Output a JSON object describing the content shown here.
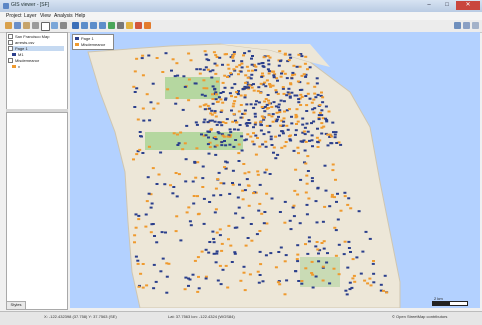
{
  "window": {
    "title": "GIS viewer - [SF]",
    "min": "–",
    "max": "□",
    "close": "✕"
  },
  "menus": [
    "Project",
    "Layer",
    "View",
    "Analysis",
    "Help"
  ],
  "sidebar": {
    "layers": [
      {
        "label": "San Francisco Map"
      },
      {
        "label": "arrests.csv"
      },
      {
        "label": "Page 1"
      },
      {
        "label": "M1"
      },
      {
        "label": "Misdemeanor"
      },
      {
        "label": "v"
      }
    ],
    "panel_tab": "Styles"
  },
  "legend": {
    "items": [
      {
        "label": "Page 1",
        "color": "#2b3f8c"
      },
      {
        "label": "Misdemeanor",
        "color": "#ef9a2e"
      }
    ]
  },
  "status": {
    "left": "X: -122.432398 (37.758) Y: 37.7563 (SE)",
    "center": "Lat: 37.7563 lon: -122.4324 (WGS84)",
    "right": "© Open StreetMap contributors"
  },
  "scale": {
    "label": "2 km"
  },
  "colors": {
    "land": "#ede7d8",
    "water": "#b3d1ff",
    "park": "#b5d7a0",
    "point_a": "#2b3f8c",
    "point_b": "#ef9a2e"
  }
}
